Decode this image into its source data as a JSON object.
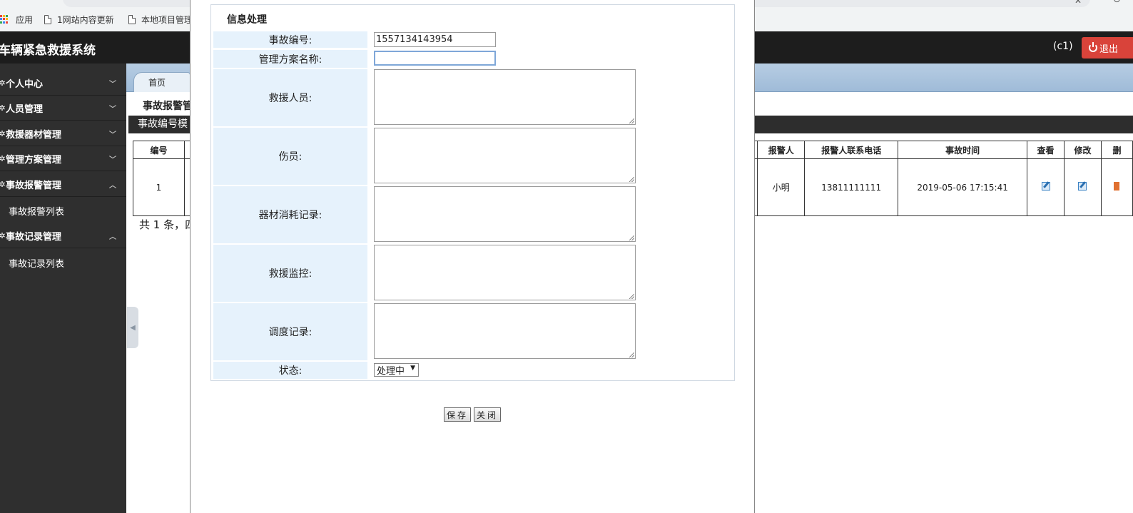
{
  "browser": {
    "bookmarks": [
      {
        "label": "应用",
        "icon": "apps-grid-icon"
      },
      {
        "label": "1网站内容更新",
        "icon": "page-icon"
      },
      {
        "label": "本地项目管理",
        "icon": "page-icon"
      }
    ]
  },
  "header": {
    "app_title": "车辆紧急救援系统",
    "user": "(c1)",
    "logout_label": "退出"
  },
  "sidebar": {
    "items": [
      {
        "label": "个人中心",
        "expanded": false
      },
      {
        "label": "人员管理",
        "expanded": false
      },
      {
        "label": "救援器材管理",
        "expanded": false
      },
      {
        "label": "管理方案管理",
        "expanded": false
      },
      {
        "label": "事故报警管理",
        "expanded": true,
        "children": [
          "事故报警列表"
        ]
      },
      {
        "label": "事故记录管理",
        "expanded": true,
        "children": [
          "事故记录列表"
        ]
      }
    ]
  },
  "content": {
    "tab_home": "首页",
    "breadcrumb": "事故报警管",
    "search_label": "事故编号模",
    "table": {
      "headers": [
        "编号",
        "报警人",
        "报警人联系电话",
        "事故时间",
        "查看",
        "修改",
        "删"
      ],
      "rows": [
        {
          "id": "1",
          "reporter": "小明",
          "phone": "13811111111",
          "time": "2019-05-06 17:15:41"
        }
      ]
    },
    "pager": "共 1 条，四"
  },
  "dialog": {
    "title": "信息处理",
    "fields": {
      "accident_no_label": "事故编号:",
      "accident_no_value": "1557134143954",
      "plan_name_label": "管理方案名称:",
      "plan_name_value": "",
      "rescuers_label": "救援人员:",
      "injured_label": "伤员:",
      "equipment_label": "器材消耗记录:",
      "monitor_label": "救援监控:",
      "dispatch_label": "调度记录:",
      "status_label": "状态:",
      "status_value": "处理中"
    },
    "save_label": "保存",
    "close_label": "关闭"
  },
  "colors": {
    "header_bg": "#1d1d1d",
    "sidebar_bg": "#2f2f2f",
    "logout_red": "#d9433a",
    "label_bg": "#e6f2fc"
  }
}
